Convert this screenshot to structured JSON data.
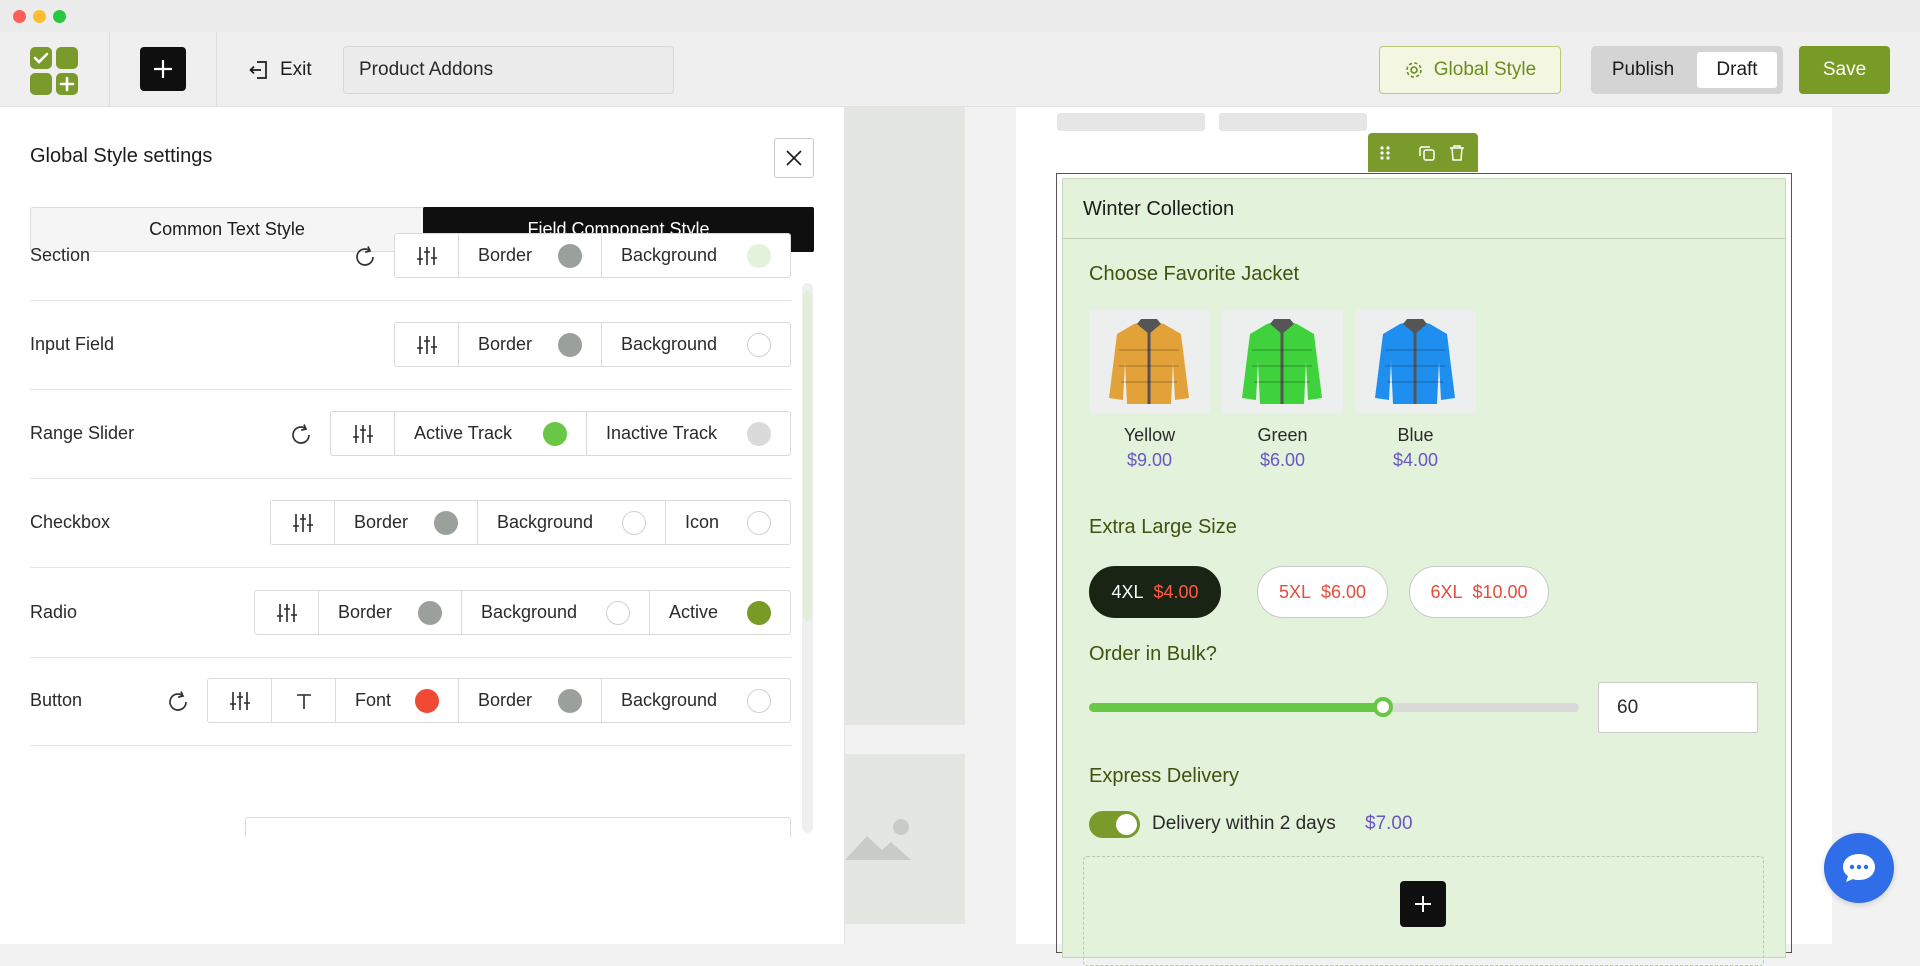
{
  "window": {
    "controls": [
      "close",
      "minimize",
      "maximize"
    ]
  },
  "toolbar": {
    "exit_label": "Exit",
    "title_value": "Product Addons",
    "global_style_label": "Global Style",
    "publish_label": "Publish",
    "draft_label": "Draft",
    "save_label": "Save",
    "accent_color": "#789b26"
  },
  "panel": {
    "title": "Global Style settings",
    "tabs": [
      {
        "label": "Common Text Style",
        "active": false
      },
      {
        "label": "Field Component Style",
        "active": true
      }
    ],
    "rows": [
      {
        "label": "Section",
        "has_reset": true,
        "options": [
          {
            "label": "Border",
            "swatch": "#9aa19a"
          },
          {
            "label": "Background",
            "swatch": "#e3f2da"
          }
        ]
      },
      {
        "label": "Input Field",
        "has_reset": false,
        "options": [
          {
            "label": "Border",
            "swatch": "#9aa19a"
          },
          {
            "label": "Background",
            "swatch": "#ffffff"
          }
        ]
      },
      {
        "label": "Range Slider",
        "has_reset": true,
        "options": [
          {
            "label": "Active Track",
            "swatch": "#68c744"
          },
          {
            "label": "Inactive Track",
            "swatch": "#dadada"
          }
        ]
      },
      {
        "label": "Checkbox",
        "has_reset": false,
        "options": [
          {
            "label": "Border",
            "swatch": "#9aa19a"
          },
          {
            "label": "Background",
            "swatch": "#ffffff"
          },
          {
            "label": "Icon",
            "swatch": "#ffffff"
          }
        ]
      },
      {
        "label": "Radio",
        "has_reset": false,
        "options": [
          {
            "label": "Border",
            "swatch": "#9aa19a"
          },
          {
            "label": "Background",
            "swatch": "#ffffff"
          },
          {
            "label": "Active",
            "swatch": "#789b26"
          }
        ]
      },
      {
        "label": "Button",
        "has_reset": true,
        "options": [
          {
            "label": "Font",
            "swatch": "#f04a35"
          },
          {
            "label": "Border",
            "swatch": "#9aa19a"
          },
          {
            "label": "Background",
            "swatch": "#ffffff"
          }
        ]
      }
    ]
  },
  "preview": {
    "section_title": "Winter Collection",
    "jacket_field_label": "Choose Favorite Jacket",
    "jackets": [
      {
        "name": "Yellow",
        "price": "$9.00",
        "color": "#e3a13a"
      },
      {
        "name": "Green",
        "price": "$6.00",
        "color": "#3fd23c"
      },
      {
        "name": "Blue",
        "price": "$4.00",
        "color": "#1f8fef"
      }
    ],
    "size_field_label": "Extra Large Size",
    "sizes": [
      {
        "name": "4XL",
        "price": "$4.00",
        "selected": true
      },
      {
        "name": "5XL",
        "price": "$6.00",
        "selected": false
      },
      {
        "name": "6XL",
        "price": "$10.00",
        "selected": false
      }
    ],
    "bulk_field_label": "Order in Bulk?",
    "bulk_value": "60",
    "bulk_slider_fraction": 0.6,
    "delivery_field_label": "Express Delivery",
    "delivery_option": "Delivery within 2 days",
    "delivery_price": "$7.00",
    "delivery_enabled": true
  }
}
